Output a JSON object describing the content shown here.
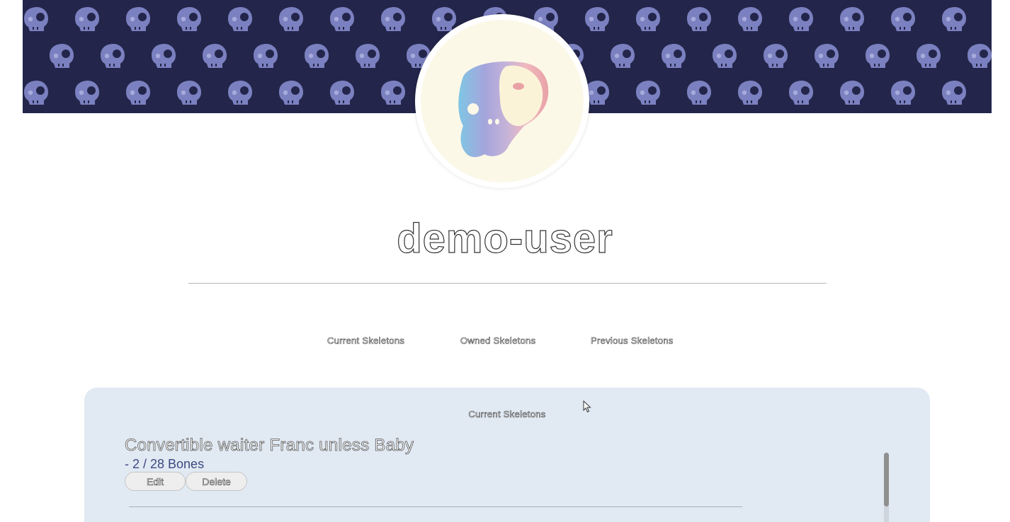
{
  "profile": {
    "username": "demo-user"
  },
  "tabs": [
    {
      "label": "Current Skeletons"
    },
    {
      "label": "Owned Skeletons"
    },
    {
      "label": "Previous Skeletons"
    }
  ],
  "panel": {
    "title": "Current Skeletons",
    "items": [
      {
        "name": "Convertible waiter Franc unless Baby",
        "bones": "- 2 / 28 Bones",
        "edit_label": "Edit",
        "delete_label": "Delete"
      }
    ]
  },
  "colors": {
    "banner_bg": "#23264a",
    "skull_pattern": "#7b80c0",
    "avatar_bg": "#fcf8e8",
    "panel_bg": "#e1e9f3",
    "bones_text": "#3c4a82"
  },
  "icons": {
    "banner": "skull-pattern",
    "avatar": "rainbow-skull-icon",
    "cursor": "mouse-pointer-icon"
  }
}
